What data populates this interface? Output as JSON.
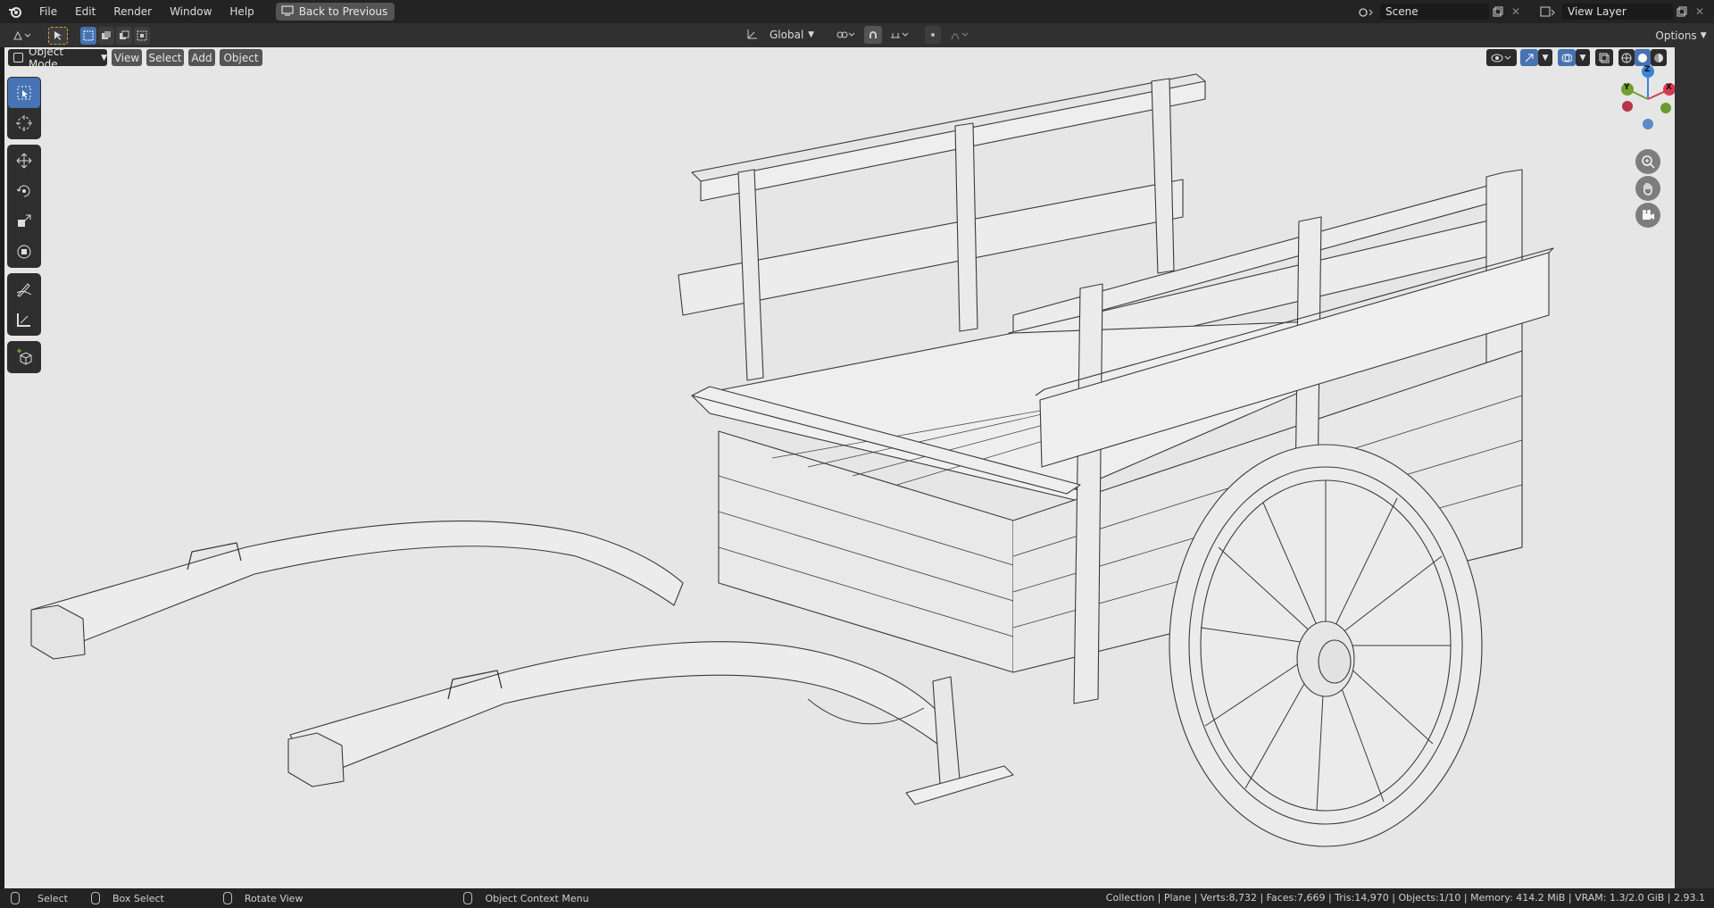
{
  "menu": {
    "items": [
      "File",
      "Edit",
      "Render",
      "Window",
      "Help"
    ],
    "back_button": "Back to Previous"
  },
  "top_right": {
    "scene_label": "Scene",
    "view_layer_label": "View Layer"
  },
  "header": {
    "transform_orientation": "Global",
    "options_label": "Options"
  },
  "viewport_header": {
    "mode": "Object Mode",
    "menus": [
      "View",
      "Select",
      "Add",
      "Object"
    ]
  },
  "gizmo": {
    "axes": [
      "X",
      "Y",
      "Z"
    ]
  },
  "status": {
    "select": "Select",
    "box_select": "Box Select",
    "rotate_view": "Rotate View",
    "context_menu": "Object Context Menu",
    "stats": "Collection | Plane | Verts:8,732 | Faces:7,669 | Tris:14,970 | Objects:1/10 | Memory: 414.2 MiB | VRAM: 1.3/2.0 GiB | 2.93.1"
  },
  "colors": {
    "accent": "#4772b3",
    "viewport_bg": "#e6e6e6",
    "wire": "#3a3a3a",
    "axis_x": "#d8394f",
    "axis_y": "#70a02e",
    "axis_z": "#3b83d8"
  }
}
